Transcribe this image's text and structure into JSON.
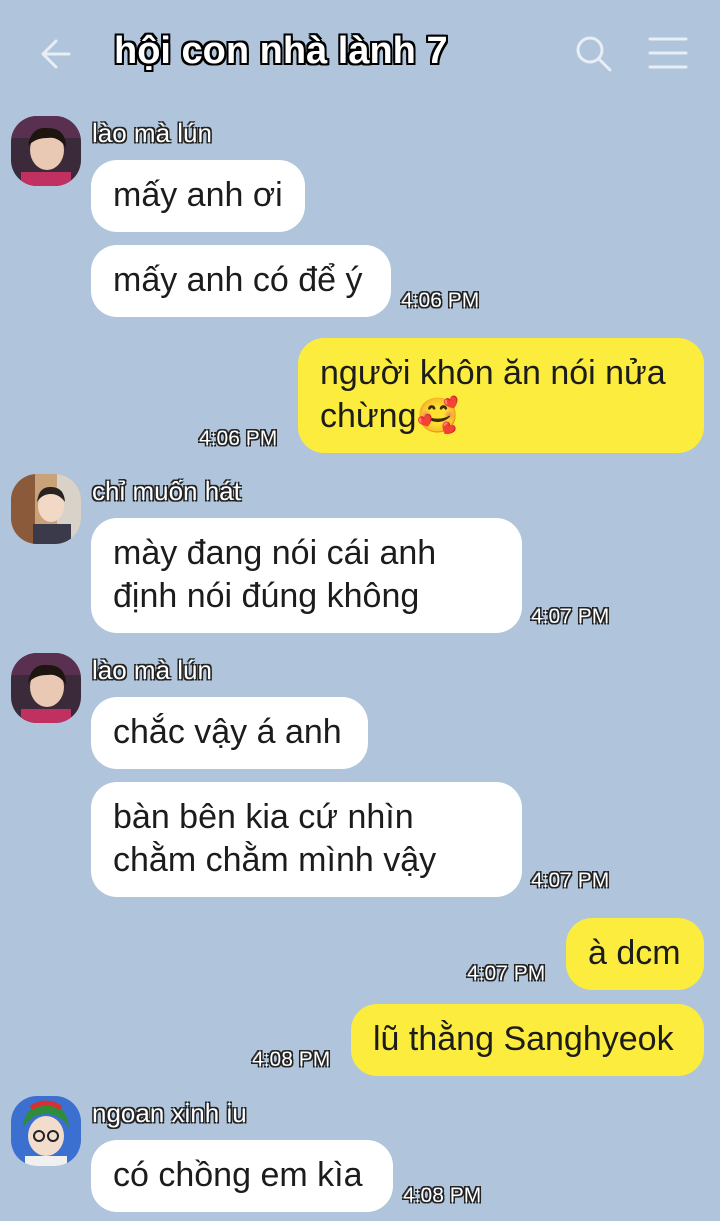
{
  "header": {
    "title": "hội con nhà lành 7"
  },
  "users": {
    "u1": "lào mà lún",
    "u2": "chỉ muốn hát",
    "u3": "ngoan xinh iu"
  },
  "messages": [
    {
      "text": "mấy anh ơi"
    },
    {
      "text": "mấy anh có để ý",
      "time": "4:06 PM"
    },
    {
      "text": "người khôn ăn nói nửa chừng🥰",
      "time": "4:06 PM"
    },
    {
      "text": "mày đang nói cái anh định nói đúng không",
      "time": "4:07 PM"
    },
    {
      "text": "chắc vậy á anh"
    },
    {
      "text": "bàn bên kia cứ nhìn chằm chằm mình vậy",
      "time": "4:07 PM"
    },
    {
      "text": "à dcm",
      "time": "4:07 PM"
    },
    {
      "text": "lũ thằng Sanghyeok",
      "time": "4:08 PM"
    },
    {
      "text": "có chồng em kìa",
      "time": "4:08 PM"
    }
  ]
}
